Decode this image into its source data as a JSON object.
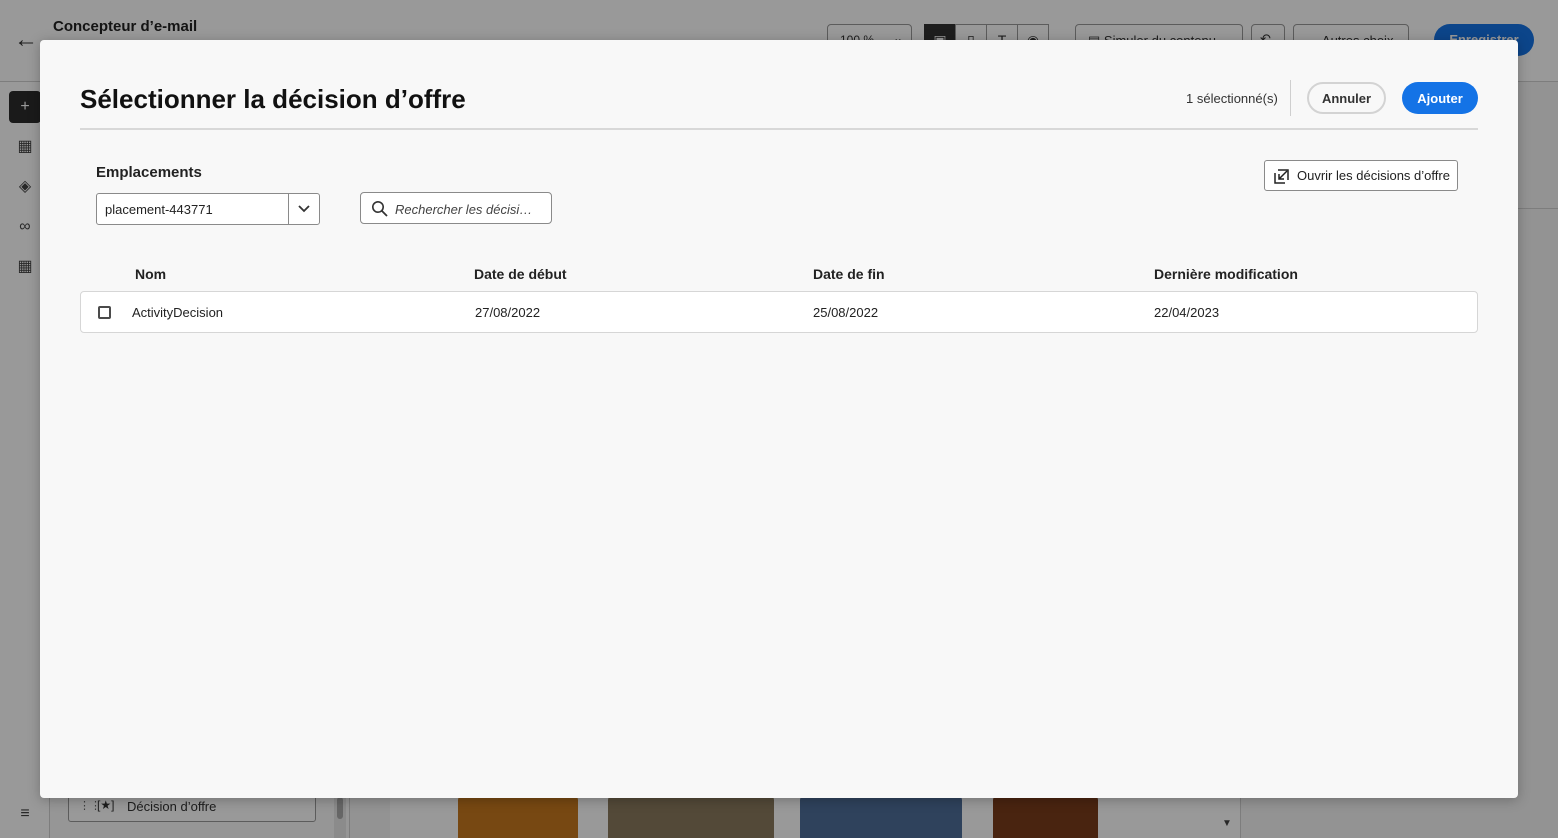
{
  "app": {
    "title": "Concepteur d’e-mail",
    "zoom_value": "100 %",
    "simulate_label": "Simuler du contenu",
    "more_label": "Autres choix",
    "save_label": "Enregistrer",
    "panel_item_label": "Décision d’offre",
    "accent_color": "#1473e6"
  },
  "dialog": {
    "title": "Sélectionner la décision d’offre",
    "selected_count": "1 sélectionné(s)",
    "cancel_label": "Annuler",
    "add_label": "Ajouter",
    "placements_label": "Emplacements",
    "placement_value": "placement-443771",
    "search_placeholder": "Rechercher les décisi…",
    "open_decisions_label": "Ouvrir les décisions d’offre",
    "table": {
      "columns": [
        "Nom",
        "Date de début",
        "Date de fin",
        "Dernière modification"
      ],
      "rows": [
        {
          "name": "ActivityDecision",
          "start": "27/08/2022",
          "end": "25/08/2022",
          "modified": "22/04/2023",
          "checked": false
        }
      ]
    }
  },
  "icons": {
    "back": "arrow-left-icon",
    "chevron": "chevron-down-icon",
    "search": "search-icon",
    "open": "open-external-icon",
    "rail": [
      "plus-icon",
      "image-icon",
      "layers-icon",
      "link-icon",
      "grid-icon",
      "stack-icon"
    ]
  }
}
